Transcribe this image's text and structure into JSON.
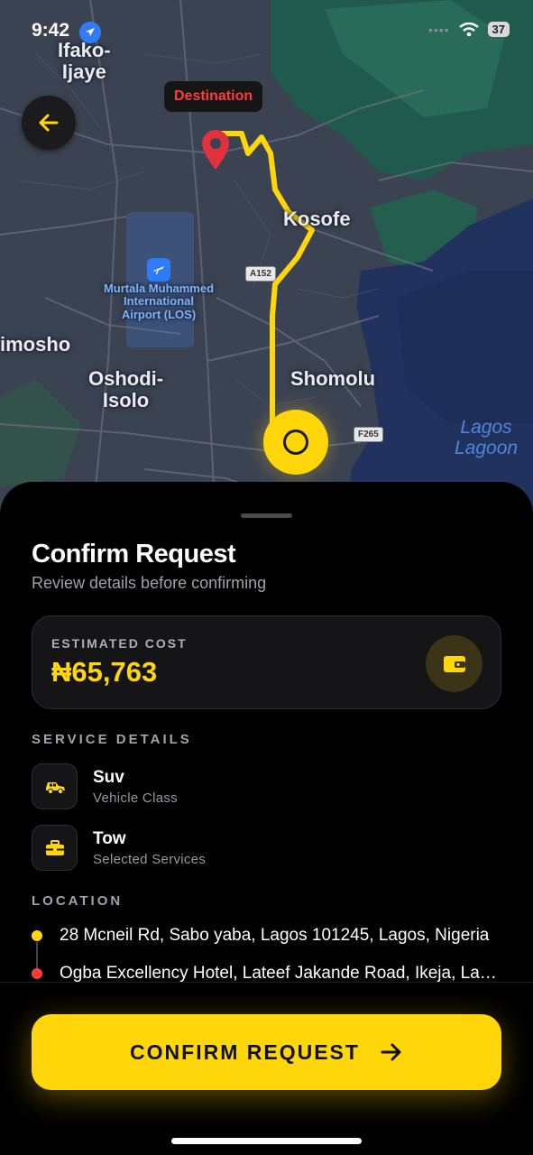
{
  "status_bar": {
    "time": "9:42",
    "battery": "37"
  },
  "map": {
    "labels": {
      "ifako": "Ifako-\nIjaye",
      "kosofe": "Kosofe",
      "ikosi": "imosho",
      "oshodi": "Oshodi-\nIsolo",
      "shomolu": "Shomolu",
      "lagoon": "Lagos\nLagoon",
      "airport": "Murtala Muhammed\nInternational\nAirport (LOS)"
    },
    "shields": {
      "a152": "A152",
      "f265": "F265"
    },
    "destination_tag": "Destination",
    "route_color": "#FFD60A"
  },
  "sheet": {
    "title": "Confirm Request",
    "subtitle": "Review details before confirming",
    "cost": {
      "label": "ESTIMATED COST",
      "value": "₦65,763"
    },
    "service_details": {
      "heading": "SERVICE DETAILS",
      "items": [
        {
          "icon": "car-icon",
          "title": "Suv",
          "subtitle": "Vehicle Class"
        },
        {
          "icon": "toolbox-icon",
          "title": "Tow",
          "subtitle": "Selected Services"
        }
      ]
    },
    "location": {
      "heading": "LOCATION",
      "pickup": "28 Mcneil Rd, Sabo yaba, Lagos 101245, Lagos, Nigeria",
      "destination": "Ogba Excellency Hotel, Lateef Jakande Road, Ikeja, Lagos"
    }
  },
  "footer": {
    "confirm_label": "CONFIRM REQUEST"
  },
  "colors": {
    "accent": "#FFD60A",
    "destination": "#FF3B3B",
    "background": "#000000"
  }
}
